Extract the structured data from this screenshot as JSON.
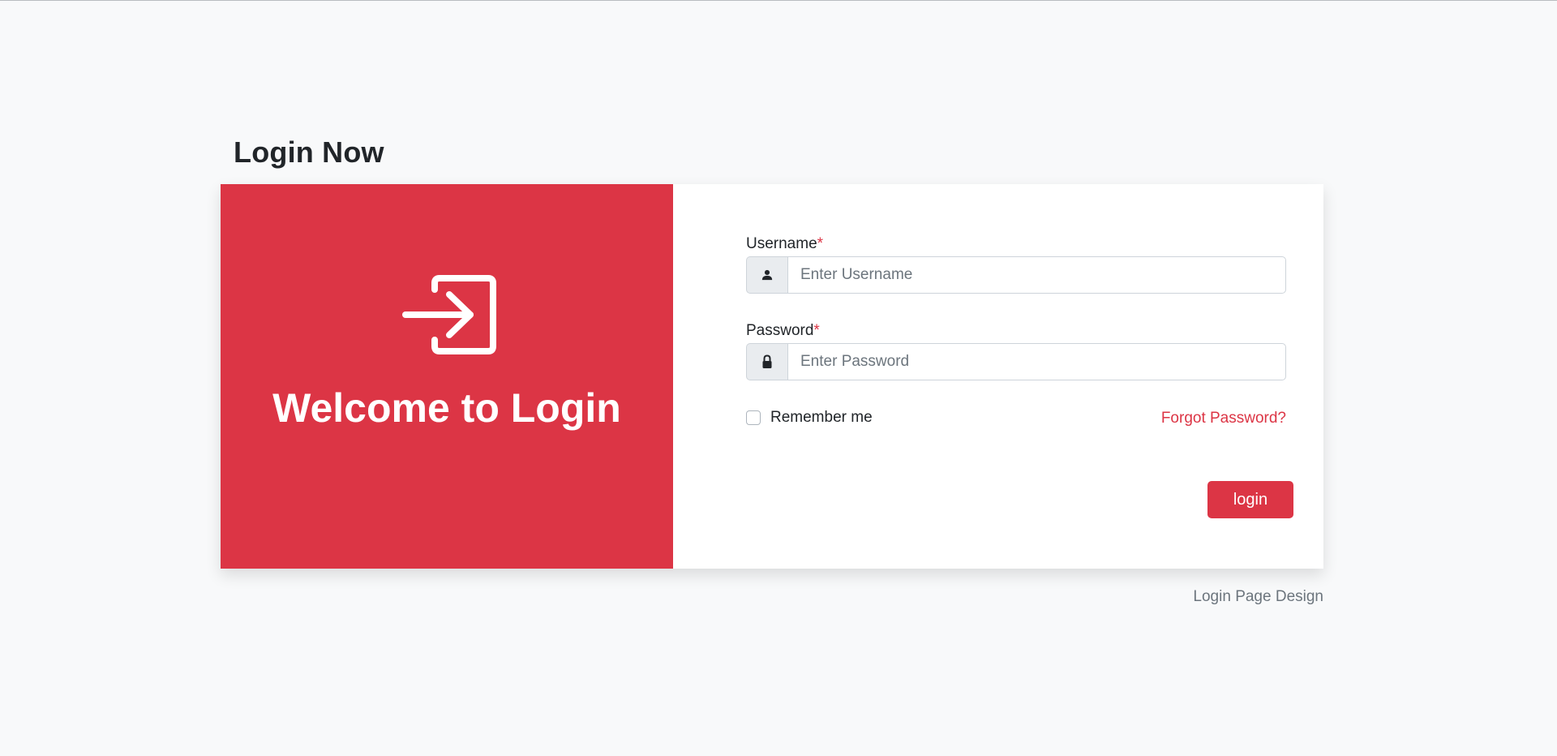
{
  "page": {
    "title": "Login Now",
    "footer": "Login Page Design"
  },
  "left_panel": {
    "icon": "login-arrow-icon",
    "welcome": "Welcome to Login",
    "color": "#dc3545"
  },
  "form": {
    "username": {
      "label": "Username",
      "required_mark": "*",
      "placeholder": "Enter Username",
      "value": "",
      "icon": "user-icon"
    },
    "password": {
      "label": "Password",
      "required_mark": "*",
      "placeholder": "Enter Password",
      "value": "",
      "icon": "lock-icon"
    },
    "remember_label": "Remember me",
    "remember_checked": false,
    "forgot_link": "Forgot Password?",
    "submit_label": "login"
  },
  "colors": {
    "accent": "#dc3545",
    "background": "#f8f9fa",
    "muted_text": "#6c757d"
  }
}
